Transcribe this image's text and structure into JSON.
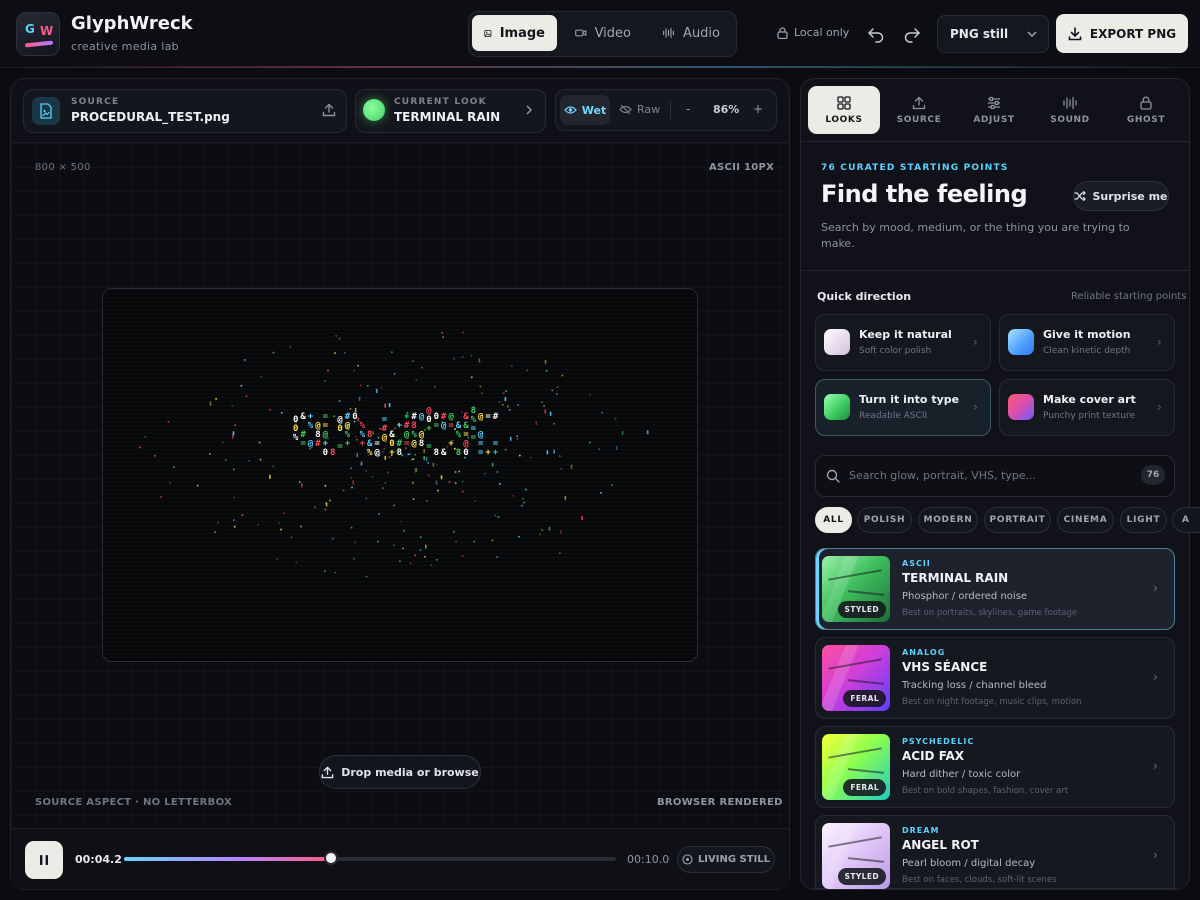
{
  "app": {
    "logo_g": "G",
    "logo_w": "W",
    "title": "GlyphWreck",
    "subtitle": "creative media lab"
  },
  "modes": [
    {
      "label": "Image",
      "icon": "image-icon",
      "active": true
    },
    {
      "label": "Video",
      "icon": "video-icon"
    },
    {
      "label": "Audio",
      "icon": "audio-icon"
    }
  ],
  "toolbar": {
    "local_only": "Local only",
    "format": "PNG still",
    "export_label": "EXPORT PNG"
  },
  "source": {
    "kicker": "SOURCE",
    "filename": "PROCEDURAL_TEST.png"
  },
  "current_look": {
    "kicker": "CURRENT LOOK",
    "name": "TERMINAL RAIN"
  },
  "view": {
    "wet": "Wet",
    "raw": "Raw",
    "zoom_minus": "-",
    "zoom": "86%",
    "zoom_plus": "+"
  },
  "stage": {
    "dims": "800 × 500",
    "ascii_size": "ASCII 10PX",
    "drop_label": "Drop media or browse",
    "aspect_note": "SOURCE ASPECT · NO LETTERBOX",
    "render_note": "BROWSER RENDERED"
  },
  "transport": {
    "time_now": "00:04.2",
    "time_end": "00:10.0",
    "progress": 0.42,
    "living_still": "LIVING STILL"
  },
  "right_tabs": [
    {
      "label": "LOOKS",
      "icon": "grid-icon",
      "active": true
    },
    {
      "label": "SOURCE",
      "icon": "upload-icon"
    },
    {
      "label": "ADJUST",
      "icon": "sliders-icon"
    },
    {
      "label": "SOUND",
      "icon": "waveform-icon"
    },
    {
      "label": "GHOST",
      "icon": "lock-icon"
    }
  ],
  "looks": {
    "curated": "76 CURATED STARTING POINTS",
    "title": "Find the feeling",
    "surprise": "Surprise me",
    "description": "Search by mood, medium, or the thing you are trying to make.",
    "quick_title": "Quick direction",
    "quick_note": "Reliable starting points",
    "quick": [
      {
        "name": "Keep it natural",
        "sub": "Soft color polish"
      },
      {
        "name": "Give it motion",
        "sub": "Clean kinetic depth"
      },
      {
        "name": "Turn it into type",
        "sub": "Readable ASCII",
        "selected": true
      },
      {
        "name": "Make cover art",
        "sub": "Punchy print texture"
      }
    ],
    "search_placeholder": "Search glow, portrait, VHS, type...",
    "count": "76",
    "chips": [
      "ALL",
      "POLISH",
      "MODERN",
      "PORTRAIT",
      "CINEMA",
      "LIGHT",
      "A"
    ],
    "items": [
      {
        "category": "ASCII",
        "name": "TERMINAL RAIN",
        "sub": "Phosphor / ordered noise",
        "best": "Best on portraits, skylines, game footage",
        "badge": "STYLED",
        "selected": true
      },
      {
        "category": "ANALOG",
        "name": "VHS SÉANCE",
        "sub": "Tracking loss / channel bleed",
        "best": "Best on night footage, music clips, motion",
        "badge": "FERAL"
      },
      {
        "category": "PSYCHEDELIC",
        "name": "ACID FAX",
        "sub": "Hard dither / toxic color",
        "best": "Best on bold shapes, fashion, cover art",
        "badge": "FERAL"
      },
      {
        "category": "DREAM",
        "name": "ANGEL ROT",
        "sub": "Pearl bloom / digital decay",
        "best": "Best on faces, clouds, soft-lit scenes",
        "badge": "STYLED"
      }
    ]
  },
  "colors": {
    "accent_cyan": "#5ad2ff",
    "accent_pink": "#ff5a8a",
    "button_light": "#ecebe6",
    "look_green": "#3fce63"
  }
}
